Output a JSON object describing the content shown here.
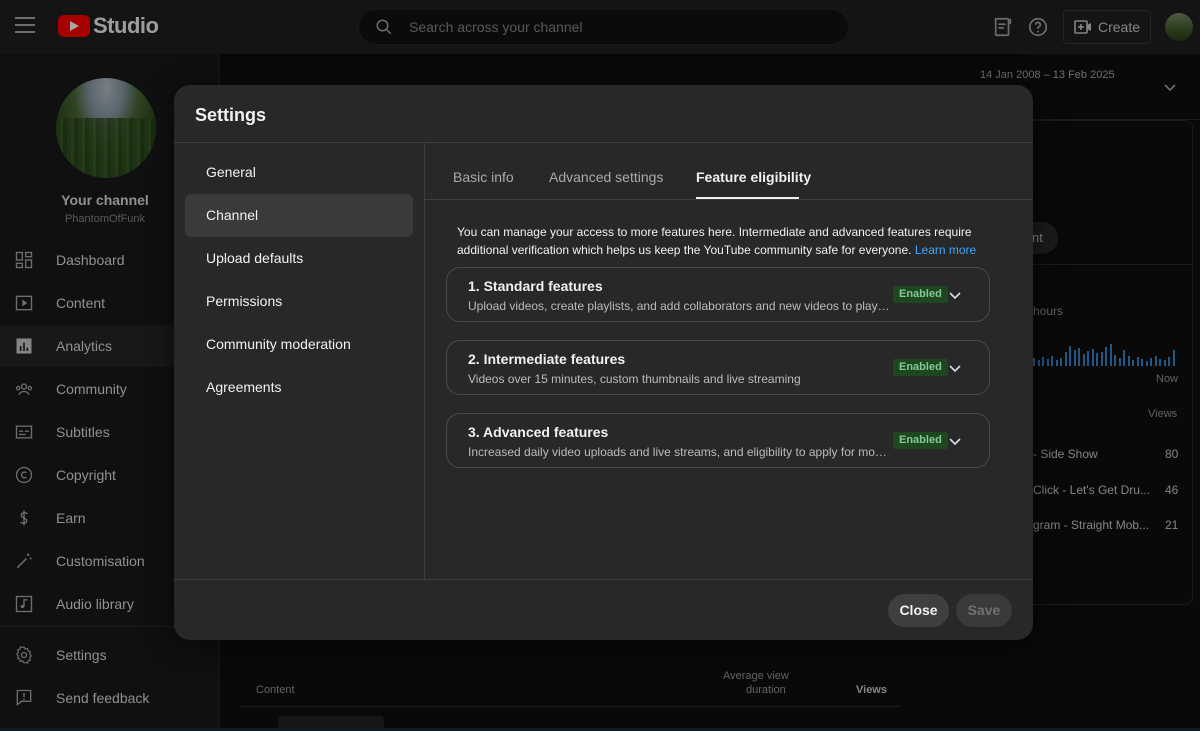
{
  "topbar": {
    "logo_text": "Studio",
    "search_placeholder": "Search across your channel",
    "create_label": "Create"
  },
  "sidebar": {
    "your_channel": "Your channel",
    "channel_name": "PhantomOfFunk",
    "items": [
      {
        "label": "Dashboard",
        "icon": "dashboard-icon"
      },
      {
        "label": "Content",
        "icon": "content-icon"
      },
      {
        "label": "Analytics",
        "icon": "analytics-icon",
        "active": true
      },
      {
        "label": "Community",
        "icon": "community-icon"
      },
      {
        "label": "Subtitles",
        "icon": "subtitles-icon"
      },
      {
        "label": "Copyright",
        "icon": "copyright-icon"
      },
      {
        "label": "Earn",
        "icon": "dollar-icon"
      },
      {
        "label": "Customisation",
        "icon": "magic-wand-icon"
      },
      {
        "label": "Audio library",
        "icon": "audio-library-icon"
      },
      {
        "label": "Settings",
        "icon": "gear-icon"
      },
      {
        "label": "Send feedback",
        "icon": "feedback-icon"
      }
    ]
  },
  "background": {
    "date_range": "14 Jan 2008 – 13 Feb 2025",
    "pill_text": "nt",
    "hours_text": "hours",
    "now_text": "Now",
    "views_header": "Views",
    "rows": [
      {
        "title": "- Side Show",
        "views": "80"
      },
      {
        "title": "Click - Let's Get Dru...",
        "views": "46"
      },
      {
        "title": "gram - Straight Mob...",
        "views": "21"
      }
    ],
    "table_content_header": "Content",
    "table_avg_header_1": "Average view",
    "table_avg_header_2": "duration",
    "table_views_header": "Views"
  },
  "modal": {
    "title": "Settings",
    "menu": [
      "General",
      "Channel",
      "Upload defaults",
      "Permissions",
      "Community moderation",
      "Agreements"
    ],
    "active_menu": "Channel",
    "tabs": [
      "Basic info",
      "Advanced settings",
      "Feature eligibility"
    ],
    "active_tab": "Feature eligibility",
    "intro_text": "You can manage your access to more features here. Intermediate and advanced features require additional verification which helps us keep the YouTube community safe for everyone.",
    "learn_more": "Learn more",
    "features": [
      {
        "title": "1. Standard features",
        "desc": "Upload videos, create playlists, and add collaborators and new videos to playlists",
        "status": "Enabled"
      },
      {
        "title": "2. Intermediate features",
        "desc": "Videos over 15 minutes, custom thumbnails and live streaming",
        "status": "Enabled"
      },
      {
        "title": "3. Advanced features",
        "desc": "Increased daily video uploads and live streams, and eligibility to apply for monetisation",
        "status": "Enabled"
      }
    ],
    "close_label": "Close",
    "save_label": "Save"
  },
  "colors": {
    "accent_link": "#3ea6ff",
    "enabled_bg": "#1e4620",
    "enabled_text": "#81c995",
    "brand_red": "#ff0000"
  }
}
